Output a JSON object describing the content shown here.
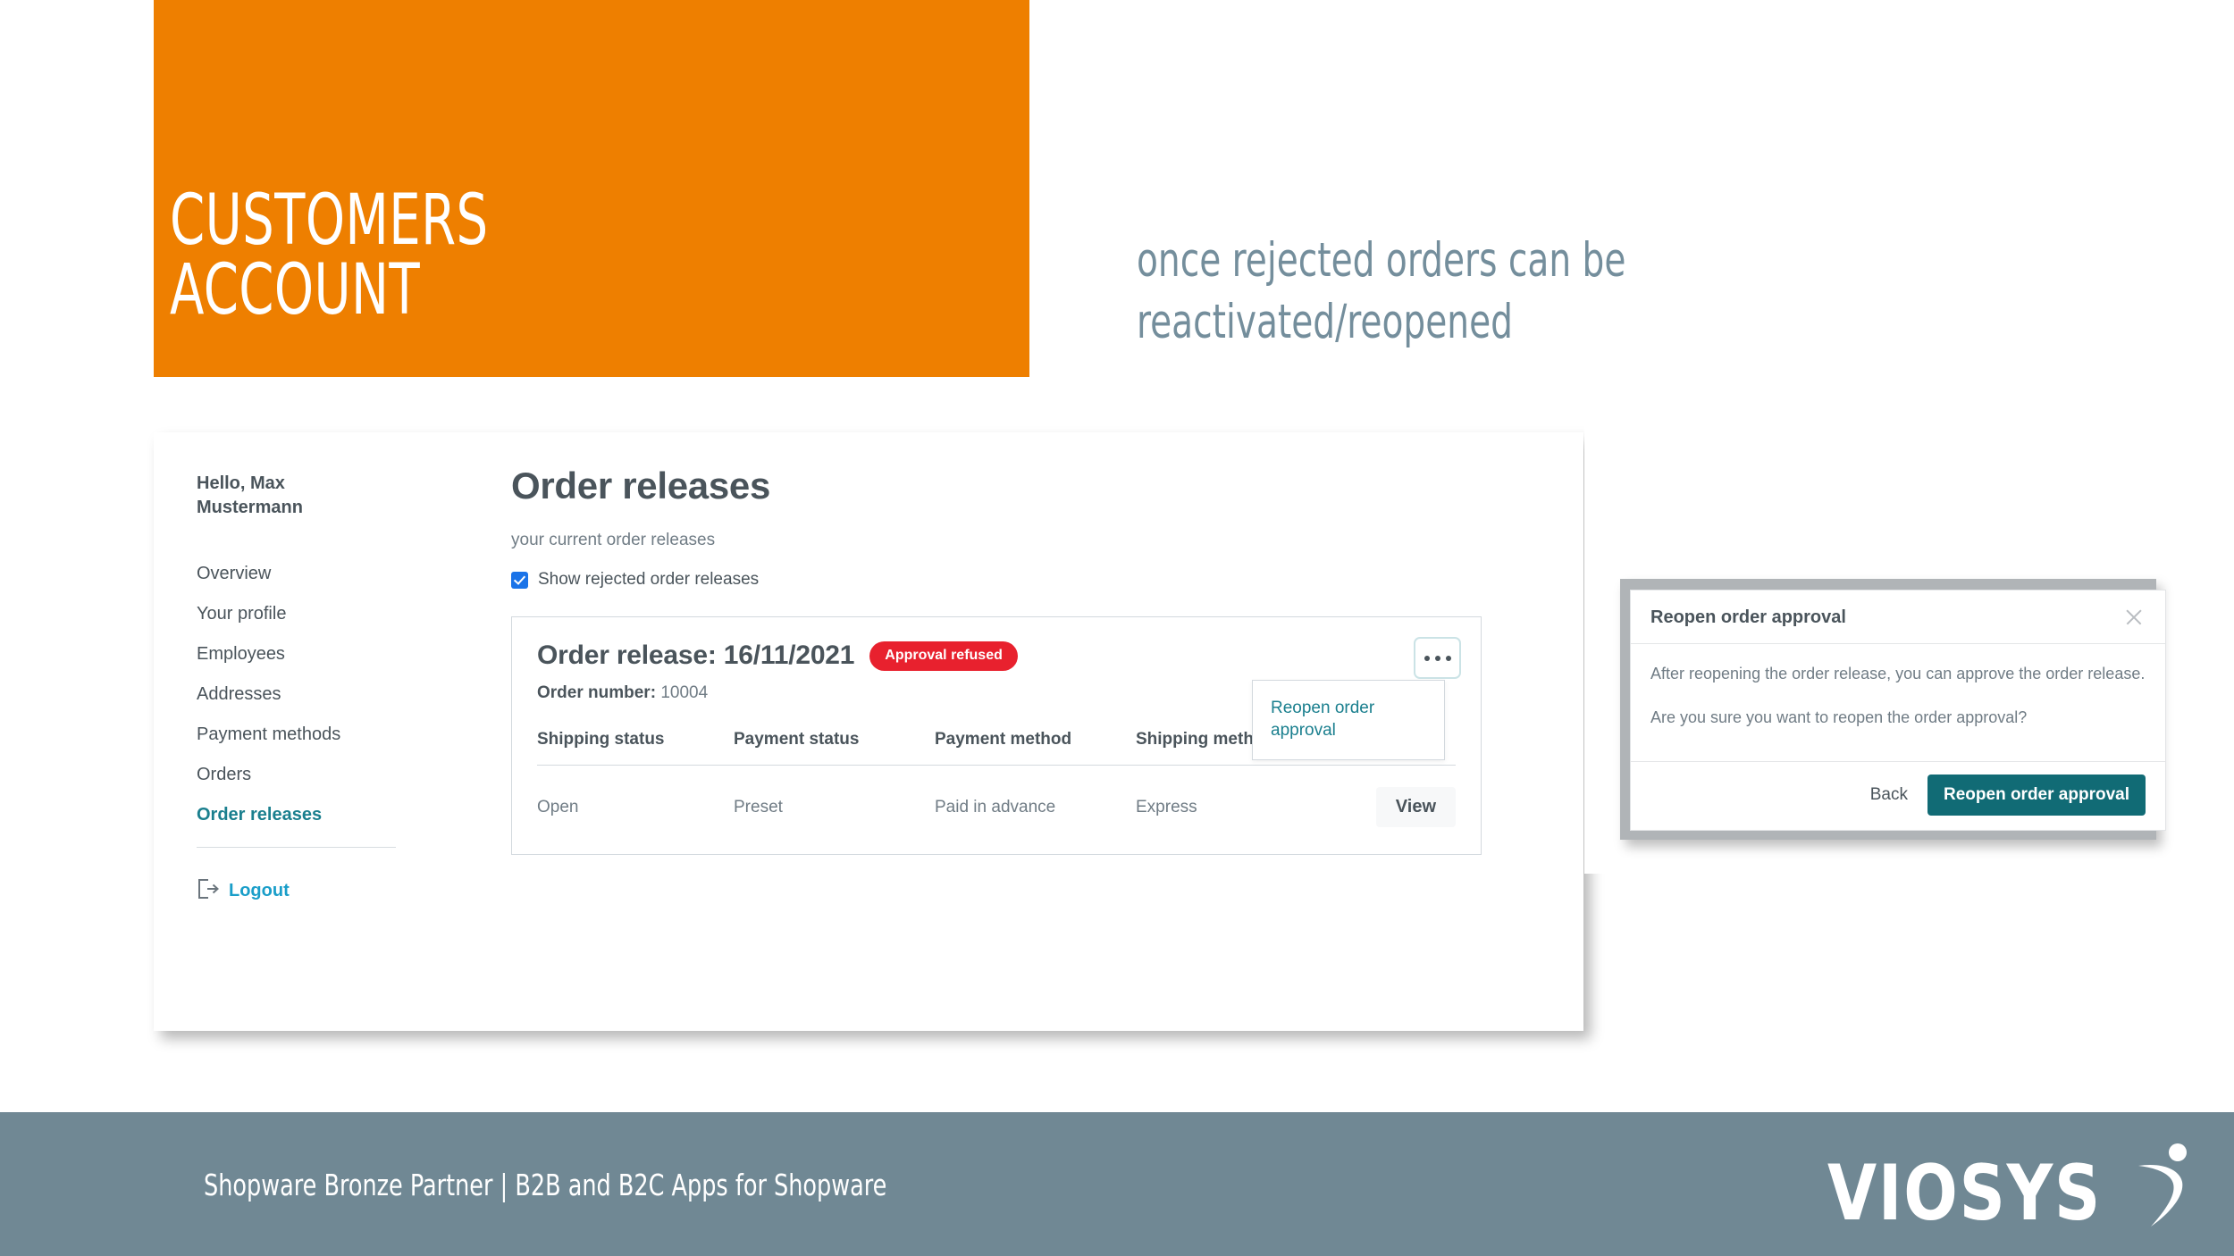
{
  "slide": {
    "title": "CUSTOMERS\nACCOUNT",
    "subtitle": "once rejected orders can be\nreactivated/reopened",
    "accent_orange": "#ee7f00",
    "subtitle_color": "#748e9c"
  },
  "sidebar": {
    "greeting": "Hello, Max\nMustermann",
    "items": [
      {
        "label": "Overview",
        "active": false
      },
      {
        "label": "Your profile",
        "active": false
      },
      {
        "label": "Employees",
        "active": false
      },
      {
        "label": "Addresses",
        "active": false
      },
      {
        "label": "Payment methods",
        "active": false
      },
      {
        "label": "Orders",
        "active": false
      },
      {
        "label": "Order releases",
        "active": true
      }
    ],
    "logout_label": "Logout",
    "logout_icon": "logout-icon"
  },
  "main": {
    "page_title": "Order releases",
    "page_subtitle": "your current order releases",
    "checkbox_label": "Show rejected order releases",
    "checkbox_checked": true,
    "checkbox_color": "#1a73e8"
  },
  "release_card": {
    "title": "Order release: 16/11/2021",
    "status_badge": "Approval refused",
    "status_color": "#e8212e",
    "order_number_label": "Order number:",
    "order_number_value": "10004",
    "kebab_icon": "more-options-icon",
    "columns": [
      "Shipping status",
      "Payment status",
      "Payment method",
      "Shipping method"
    ],
    "rows": [
      {
        "shipping_status": "Open",
        "payment_status": "Preset",
        "payment_method": "Paid in advance",
        "shipping_method": "Express",
        "action": "View"
      }
    ]
  },
  "dropdown": {
    "items": [
      "Reopen order approval"
    ],
    "link_color": "#1a7f8e"
  },
  "modal": {
    "title": "Reopen order approval",
    "close_icon": "close-icon",
    "paragraphs": [
      "After reopening the order release, you can approve the order release.",
      "Are you sure you want to reopen the order approval?"
    ],
    "back_label": "Back",
    "primary_label": "Reopen order approval",
    "primary_color": "#116b75"
  },
  "footer": {
    "text": "Shopware Bronze Partner  |  B2B and B2C Apps for Shopware",
    "logo_word": "VIOSYS",
    "background": "#708894"
  }
}
